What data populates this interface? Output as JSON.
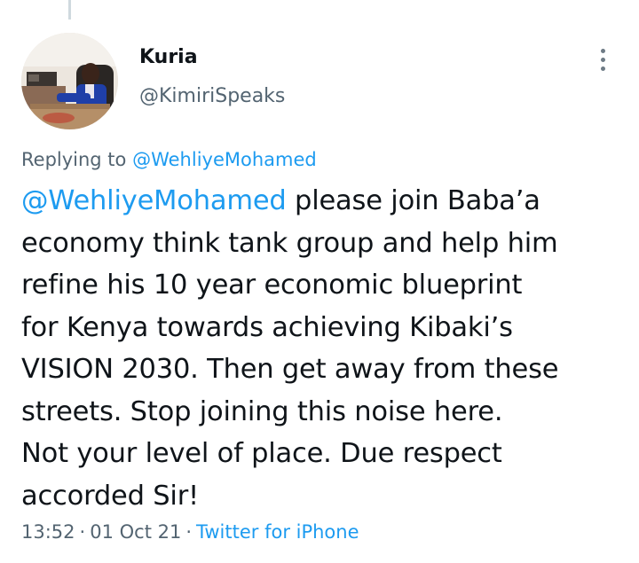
{
  "author": {
    "display_name": "Kuria",
    "handle": "@KimiriSpeaks"
  },
  "more_icon": "more-vertical-icon",
  "reply_context": {
    "prefix": "Replying to",
    "mention": "@WehliyeMohamed"
  },
  "tweet": {
    "mention": "@WehliyeMohamed",
    "first_line_rest": " please join Baba’a",
    "lines": [
      "economy think tank group and help him",
      "refine his 10 year economic blueprint",
      "for Kenya towards achieving Kibaki’s",
      "VISION 2030. Then get away from these",
      "streets. Stop joining this noise here.",
      "Not your level of place. Due respect",
      "accorded Sir!"
    ]
  },
  "meta": {
    "time": "13:52",
    "date": "01 Oct 21",
    "separator": "·",
    "source": "Twitter for iPhone"
  },
  "colors": {
    "link": "#1d9bf0",
    "secondary_text": "#536471",
    "primary_text": "#0f1419"
  }
}
